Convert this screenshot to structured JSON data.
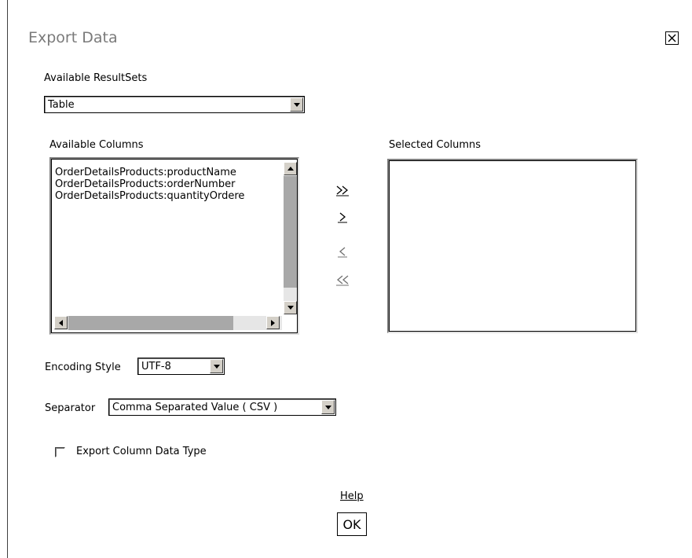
{
  "dialog": {
    "title": "Export Data",
    "close_icon": "close-x-icon"
  },
  "resultsets": {
    "label": "Available ResultSets",
    "selected": "Table"
  },
  "available_columns": {
    "label": "Available Columns",
    "items": [
      "OrderDetailsProducts:productName",
      "OrderDetailsProducts:orderNumber",
      "OrderDetailsProducts:quantityOrdere"
    ]
  },
  "selected_columns": {
    "label": "Selected Columns",
    "items": []
  },
  "move_buttons": {
    "add_all_icon": "double-chevron-right-icon",
    "add_one_icon": "chevron-right-icon",
    "remove_one_icon": "chevron-left-icon",
    "remove_all_icon": "double-chevron-left-icon"
  },
  "encoding": {
    "label": "Encoding Style",
    "selected": "UTF-8"
  },
  "separator": {
    "label": "Separator",
    "selected": "Comma Separated Value ( CSV )"
  },
  "export_type": {
    "label": "Export Column Data Type",
    "checked": false
  },
  "footer": {
    "help_label": "Help",
    "ok_label": "OK"
  },
  "colors": {
    "title": "#7a7a7a",
    "scrollbar_track": "#e6e6e6",
    "scrollbar_thumb": "#a8a8a8",
    "button_face": "#d4d0c8"
  }
}
